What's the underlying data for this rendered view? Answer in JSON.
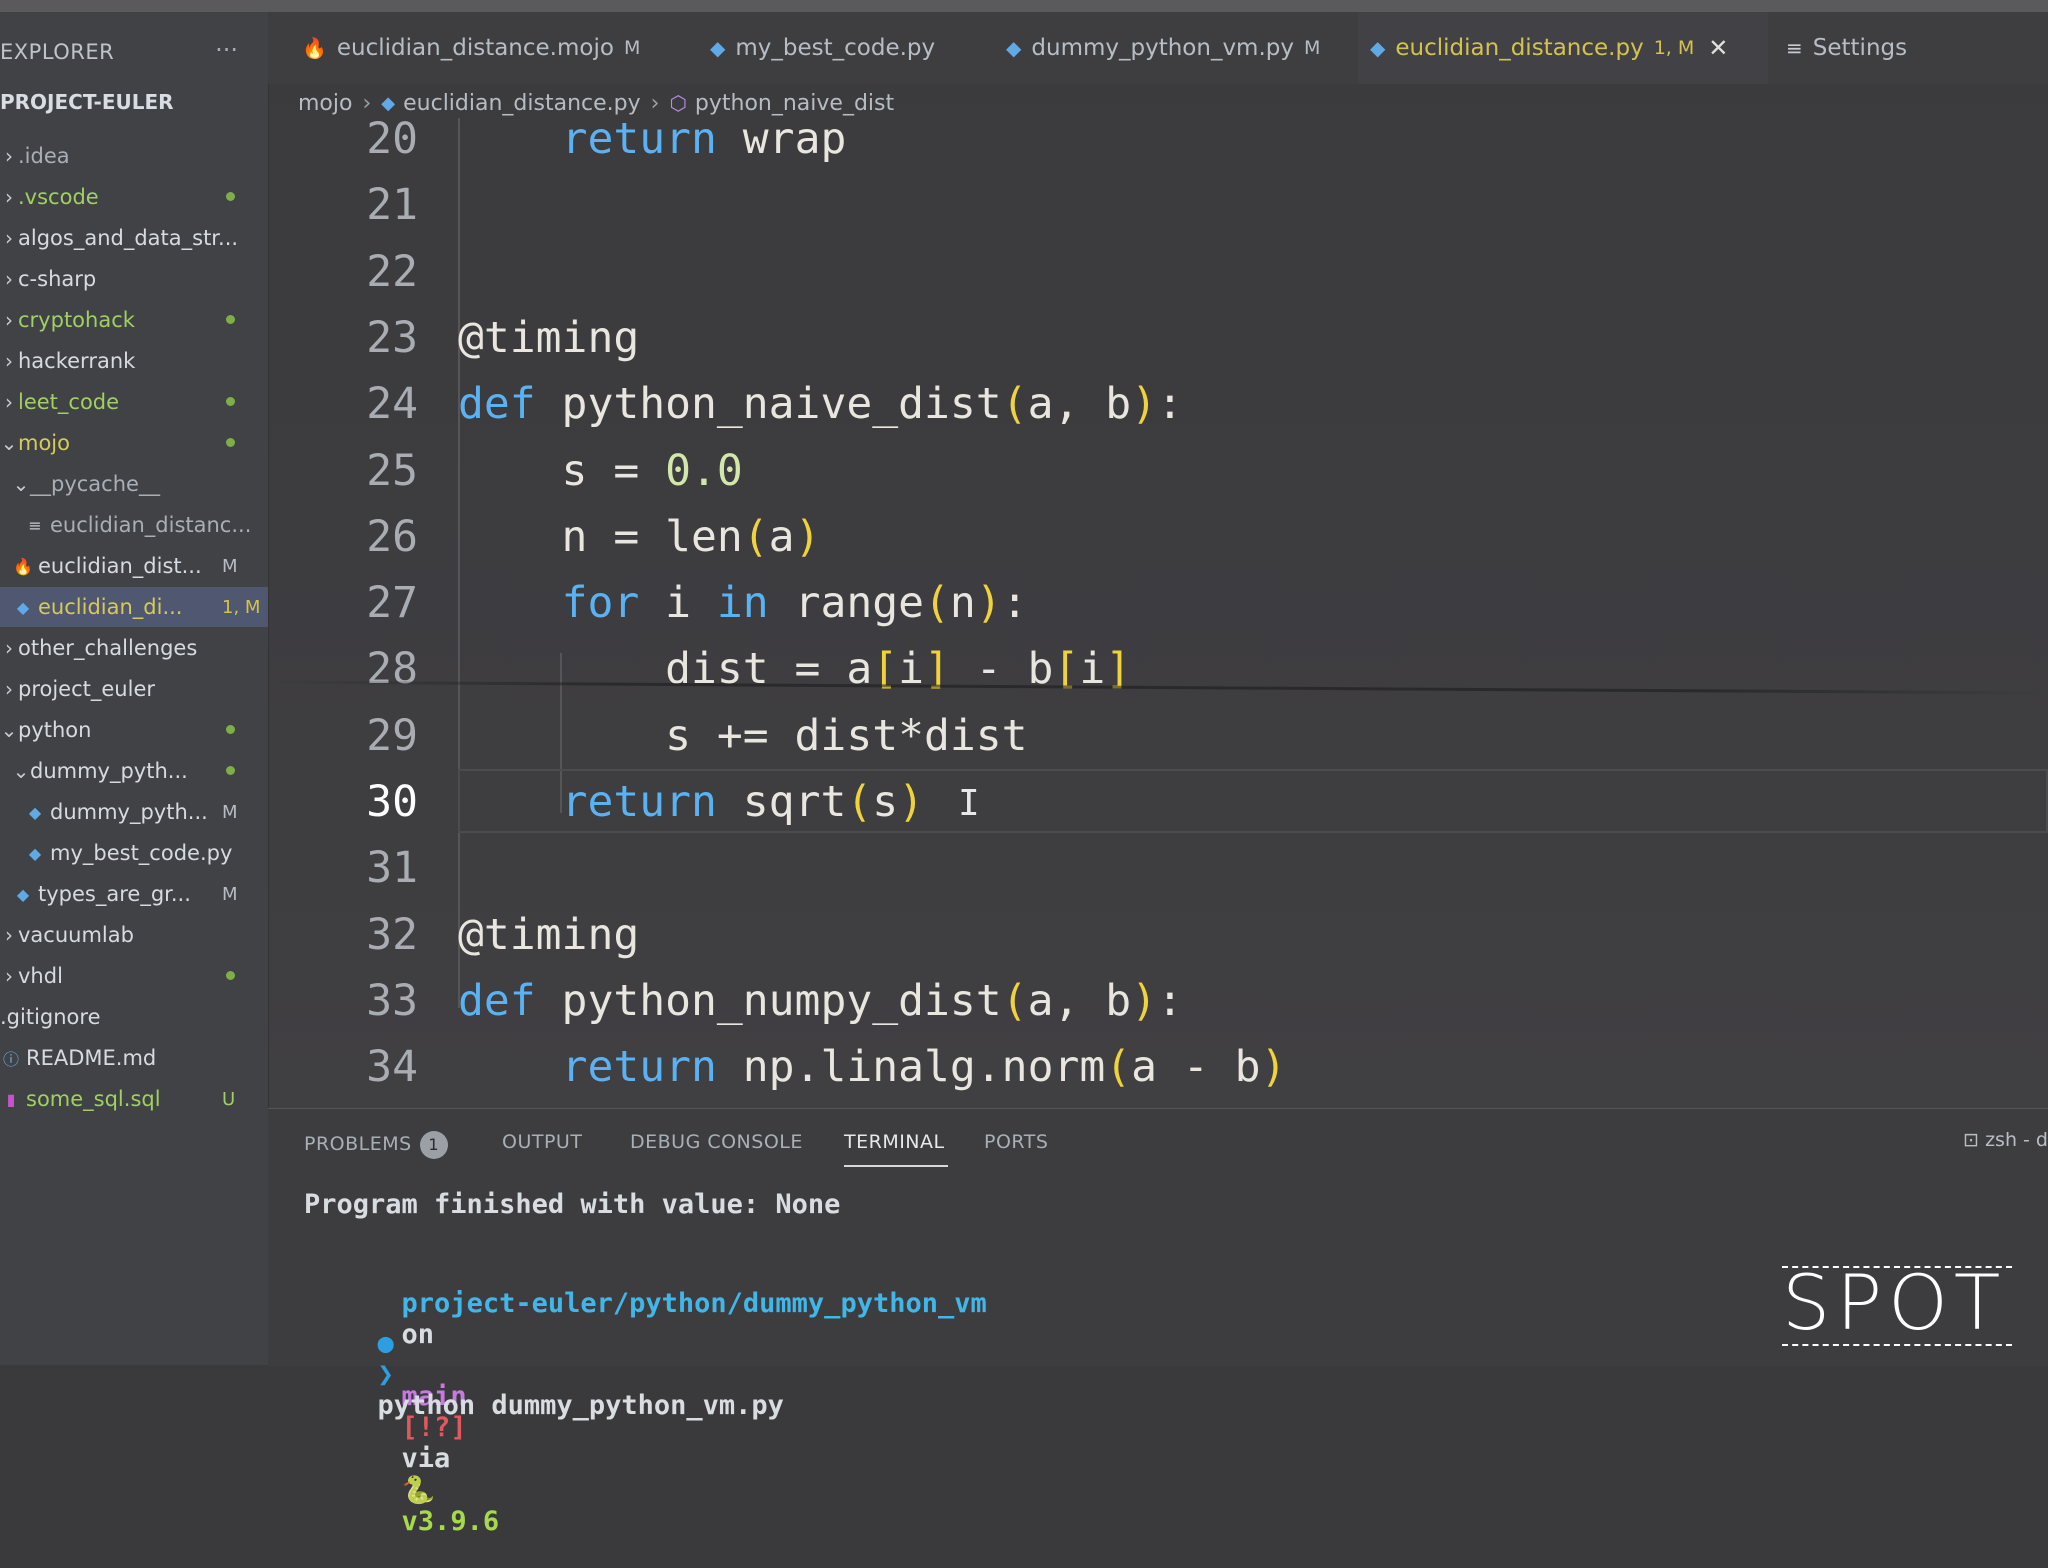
{
  "sidebar": {
    "header": "EXPLORER",
    "more": "···",
    "project": "PROJECT-EULER",
    "items": [
      {
        "chev": "›",
        "icon": "",
        "label": ".idea",
        "color": "gray",
        "badge": "",
        "dot": false
      },
      {
        "chev": "›",
        "icon": "",
        "label": ".vscode",
        "color": "green",
        "badge": "",
        "dot": true
      },
      {
        "chev": "›",
        "icon": "",
        "label": "algos_and_data_str...",
        "color": "white",
        "badge": "",
        "dot": false
      },
      {
        "chev": "›",
        "icon": "",
        "label": "c-sharp",
        "color": "white",
        "badge": "",
        "dot": false
      },
      {
        "chev": "›",
        "icon": "",
        "label": "cryptohack",
        "color": "green",
        "badge": "",
        "dot": true
      },
      {
        "chev": "›",
        "icon": "",
        "label": "hackerrank",
        "color": "white",
        "badge": "",
        "dot": false
      },
      {
        "chev": "›",
        "icon": "",
        "label": "leet_code",
        "color": "green",
        "badge": "",
        "dot": true
      },
      {
        "chev": "⌄",
        "icon": "",
        "label": "mojo",
        "color": "yellow",
        "badge": "",
        "dot": true
      },
      {
        "chev": "⌄",
        "icon": "",
        "label": "__pycache__",
        "color": "gray",
        "badge": "",
        "dot": false
      },
      {
        "chev": "",
        "icon": "≡",
        "label": "euclidian_distanc...",
        "color": "gray",
        "badge": "",
        "dot": false
      },
      {
        "chev": "",
        "icon": "🔥",
        "label": "euclidian_dist...",
        "color": "white",
        "badge": "M",
        "dot": false
      },
      {
        "chev": "",
        "icon": "◆",
        "label": "euclidian_di...",
        "color": "yellow",
        "badge": "1, M",
        "dot": false
      },
      {
        "chev": "›",
        "icon": "",
        "label": "other_challenges",
        "color": "white",
        "badge": "",
        "dot": false
      },
      {
        "chev": "›",
        "icon": "",
        "label": "project_euler",
        "color": "white",
        "badge": "",
        "dot": false
      },
      {
        "chev": "⌄",
        "icon": "",
        "label": "python",
        "color": "white",
        "badge": "",
        "dot": true
      },
      {
        "chev": "⌄",
        "icon": "",
        "label": "dummy_pyth...",
        "color": "white",
        "badge": "",
        "dot": true
      },
      {
        "chev": "",
        "icon": "◆",
        "label": "dummy_pyth...",
        "color": "white",
        "badge": "M",
        "dot": false
      },
      {
        "chev": "",
        "icon": "◆",
        "label": "my_best_code.py",
        "color": "white",
        "badge": "",
        "dot": false
      },
      {
        "chev": "",
        "icon": "◆",
        "label": "types_are_gr...",
        "color": "white",
        "badge": "M",
        "dot": false
      },
      {
        "chev": "›",
        "icon": "",
        "label": "vacuumlab",
        "color": "white",
        "badge": "",
        "dot": false
      },
      {
        "chev": "›",
        "icon": "",
        "label": "vhdl",
        "color": "white",
        "badge": "",
        "dot": true
      },
      {
        "chev": "",
        "icon": "",
        "label": ".gitignore",
        "color": "white",
        "badge": "",
        "dot": false
      },
      {
        "chev": "",
        "icon": "ⓘ",
        "label": "README.md",
        "color": "white",
        "badge": "",
        "dot": false
      },
      {
        "chev": "",
        "icon": "▮",
        "label": "some_sql.sql",
        "color": "green",
        "badge": "U",
        "dot": false
      }
    ]
  },
  "tabs": [
    {
      "icon": "🔥",
      "label": "euclidian_distance.mojo",
      "mod": "M",
      "active": false
    },
    {
      "icon": "◆",
      "label": "my_best_code.py",
      "mod": "",
      "active": false
    },
    {
      "icon": "◆",
      "label": "dummy_python_vm.py",
      "mod": "M",
      "active": false
    },
    {
      "icon": "◆",
      "label": "euclidian_distance.py",
      "mod": "1, M",
      "active": true
    },
    {
      "icon": "≡",
      "label": "Settings",
      "mod": "",
      "active": false
    }
  ],
  "close_glyph": "✕",
  "breadcrumb": {
    "folder": "mojo",
    "file": "euclidian_distance.py",
    "symbol": "python_naive_dist",
    "sep": "›"
  },
  "editor": {
    "current_line": 30,
    "lines": [
      {
        "n": "20",
        "code": "    return wrap"
      },
      {
        "n": "21",
        "code": ""
      },
      {
        "n": "22",
        "code": ""
      },
      {
        "n": "23",
        "code": "@timing"
      },
      {
        "n": "24",
        "code": "def python_naive_dist(a, b):"
      },
      {
        "n": "25",
        "code": "    s = 0.0"
      },
      {
        "n": "26",
        "code": "    n = len(a)"
      },
      {
        "n": "27",
        "code": "    for i in range(n):"
      },
      {
        "n": "28",
        "code": "        dist = a[i] - b[i]"
      },
      {
        "n": "29",
        "code": "        s += dist*dist"
      },
      {
        "n": "30",
        "code": "    return sqrt(s)"
      },
      {
        "n": "31",
        "code": ""
      },
      {
        "n": "32",
        "code": "@timing"
      },
      {
        "n": "33",
        "code": "def python_numpy_dist(a, b):"
      },
      {
        "n": "34",
        "code": "    return np.linalg.norm(a - b)"
      }
    ]
  },
  "panel": {
    "tabs": [
      "PROBLEMS",
      "OUTPUT",
      "DEBUG CONSOLE",
      "TERMINAL",
      "PORTS"
    ],
    "problems_count": "1",
    "active_tab": "TERMINAL",
    "shell": "zsh - d",
    "terminal": {
      "output": "Program finished with value: None",
      "prompt_path": "project-euler/python/dummy_python_vm",
      "on": "on",
      "branch_icon": "",
      "branch": "main",
      "status": "[!?]",
      "via": "via",
      "py_icon": "🐍",
      "version": "v3.9.6",
      "prompt_dot": "●",
      "prompt_char": "❯",
      "command": "python dummy_python_vm.py"
    }
  },
  "watermark": "SPOT",
  "colors": {
    "keyword": "#5ab2f2",
    "bracket": "#f0d23c",
    "number": "#d2e7a9",
    "modified": "#d4c24f",
    "untracked": "#9fd061"
  }
}
